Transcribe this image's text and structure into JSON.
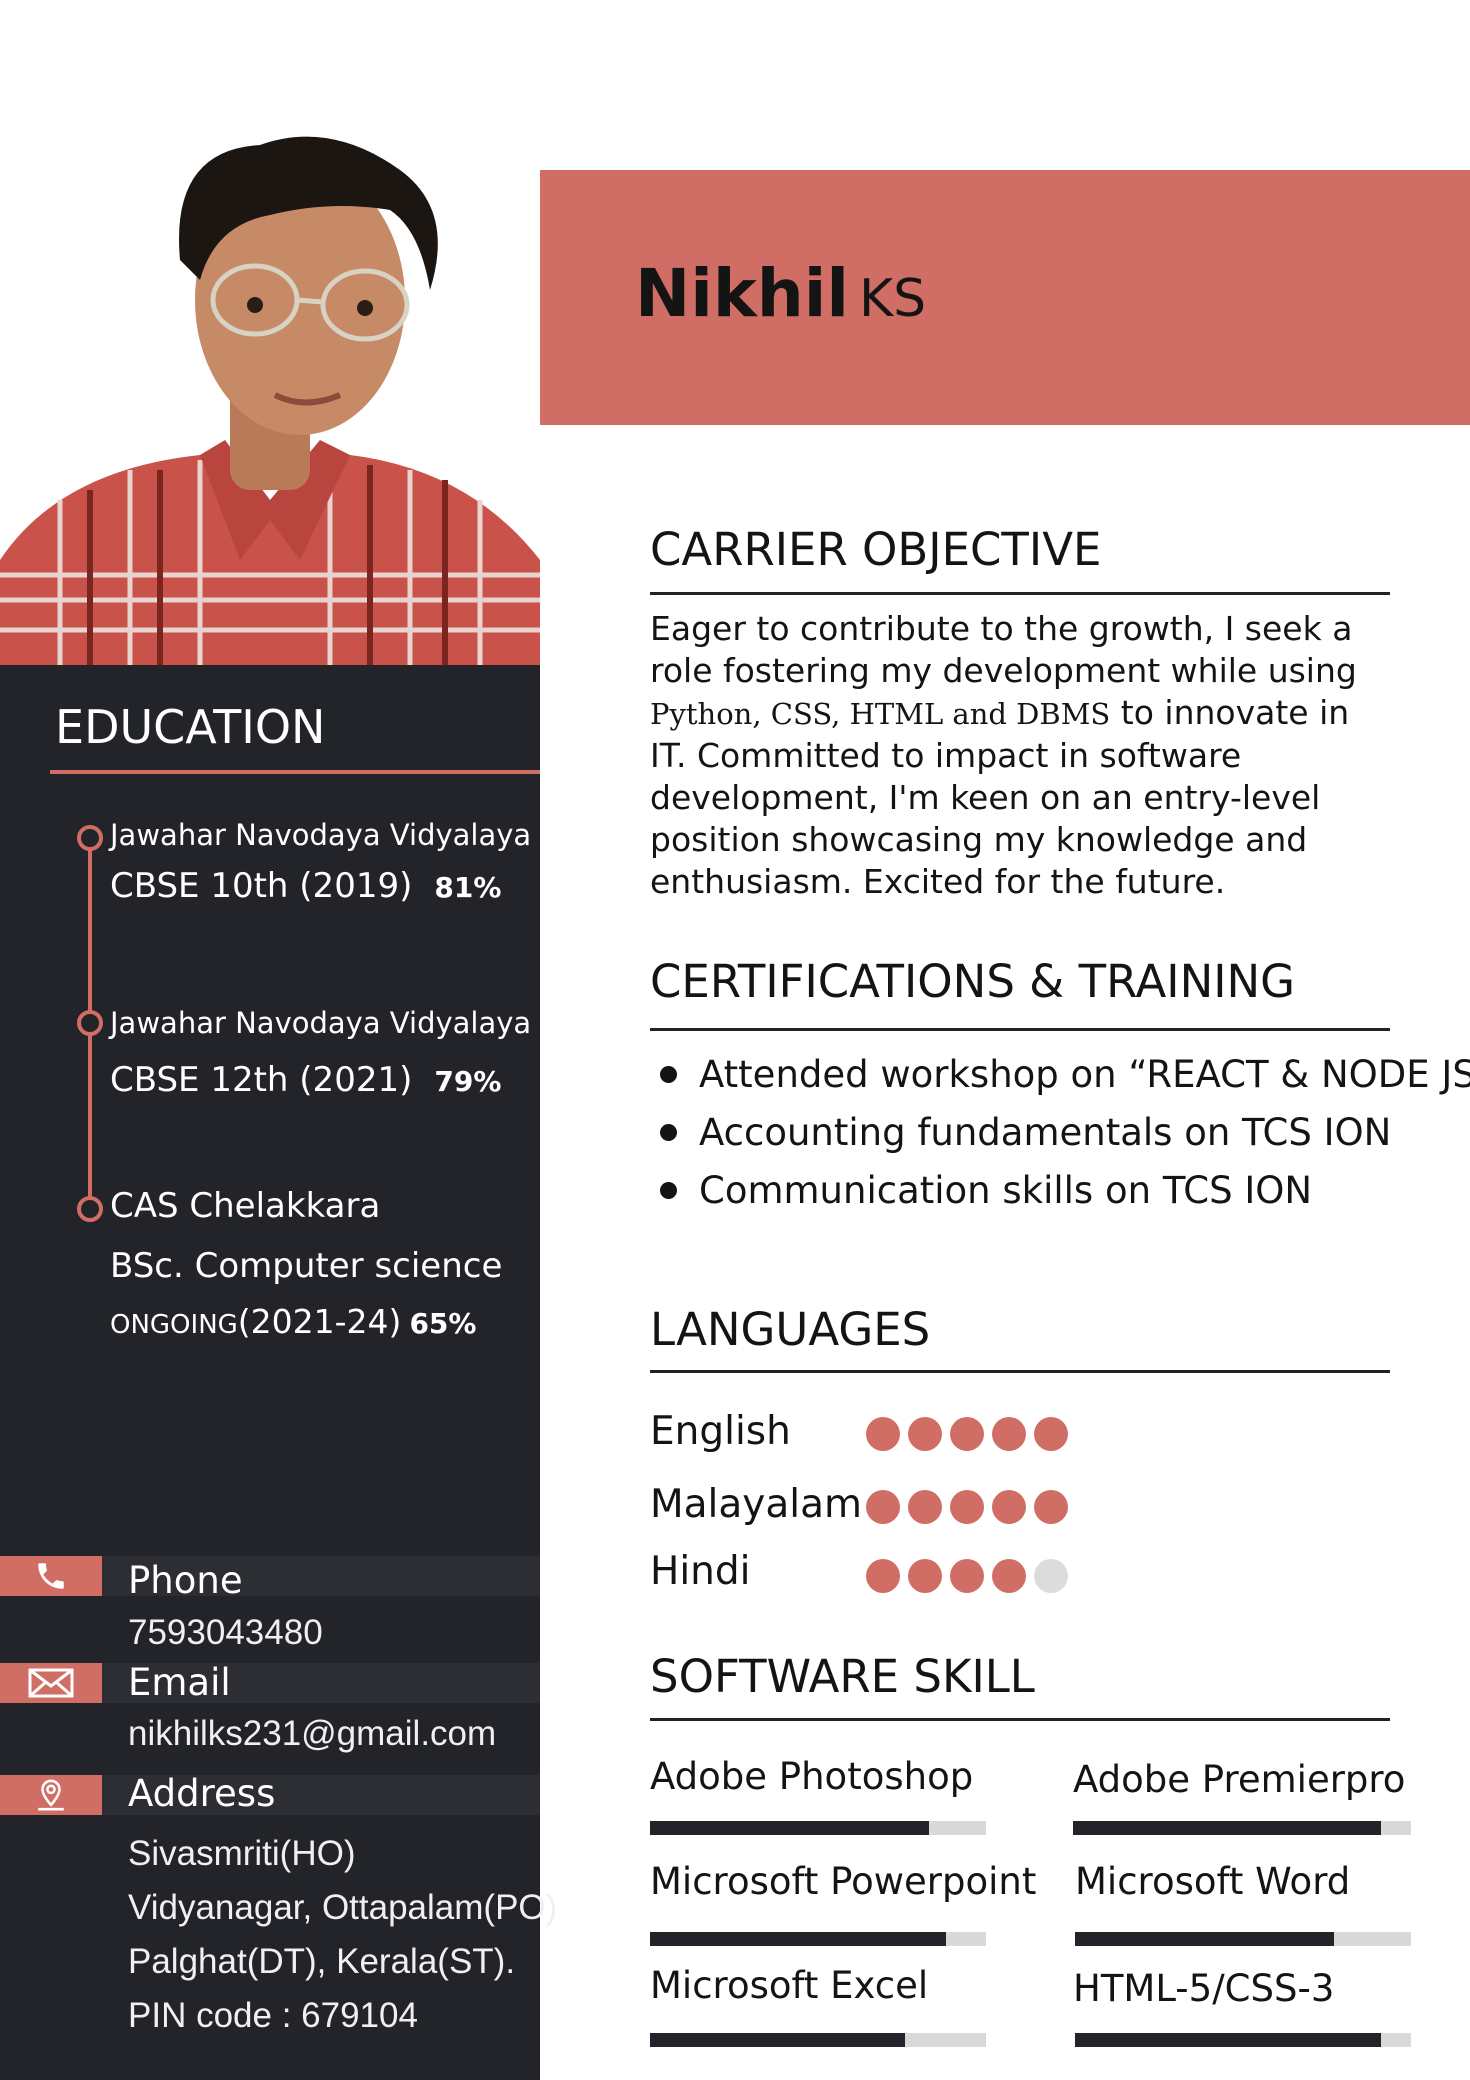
{
  "header": {
    "first_name": "Nikhil",
    "last_name": "KS"
  },
  "education": {
    "title": "EDUCATION",
    "entries": [
      {
        "school": "Jawahar Navodaya Vidyalaya",
        "course": "CBSE 10th (2019)",
        "score": "81%"
      },
      {
        "school": "Jawahar Navodaya Vidyalaya",
        "course": "CBSE 12th (2021)",
        "score": "79%"
      },
      {
        "school": "CAS Chelakkara",
        "course": "BSc. Computer science",
        "status": "ONGOING",
        "years": "(2021-24)",
        "score": "65%"
      }
    ]
  },
  "contact": {
    "phone_label": "Phone",
    "phone": "7593043480",
    "email_label": "Email",
    "email": "nikhilks231@gmail.com",
    "address_label": "Address",
    "address_lines": [
      "Sivasmriti(HO)",
      "Vidyanagar, Ottapalam(PO)",
      "Palghat(DT), Kerala(ST).",
      "PIN code : 679104"
    ]
  },
  "objective": {
    "title": "CARRIER OBJECTIVE",
    "text_1": "Eager to contribute to the growth, I seek a role fostering my development while using ",
    "tech_1": "Python, CSS, HTML and DBMS",
    "text_2": " to innovate in IT. Committed  to impact in software development, I'm keen on  an entry-level position showcasing my  knowledge  and enthusiasm. Excited for the future."
  },
  "certifications": {
    "title": "CERTIFICATIONS & TRAINING",
    "items": [
      "Attended workshop on “REACT & NODE JS”",
      "Accounting fundamentals on TCS ION",
      "Communication skills on TCS ION"
    ]
  },
  "languages": {
    "title": "LANGUAGES",
    "items": [
      {
        "name": "English",
        "rating": 5,
        "max": 5
      },
      {
        "name": "Malayalam",
        "rating": 5,
        "max": 5
      },
      {
        "name": "Hindi",
        "rating": 4,
        "max": 5
      }
    ]
  },
  "skills": {
    "title": "SOFTWARE SKILL",
    "items": [
      {
        "name": "Adobe Photoshop",
        "level": 0.83
      },
      {
        "name": "Adobe Premierpro",
        "level": 0.91
      },
      {
        "name": "Microsoft Powerpoint",
        "level": 0.88
      },
      {
        "name": "Microsoft Word",
        "level": 0.77
      },
      {
        "name": "Microsoft Excel",
        "level": 0.76
      },
      {
        "name": "HTML-5/CSS-3",
        "level": 0.91
      }
    ]
  },
  "colors": {
    "accent": "#d06e66",
    "sidebar": "#23242a"
  }
}
